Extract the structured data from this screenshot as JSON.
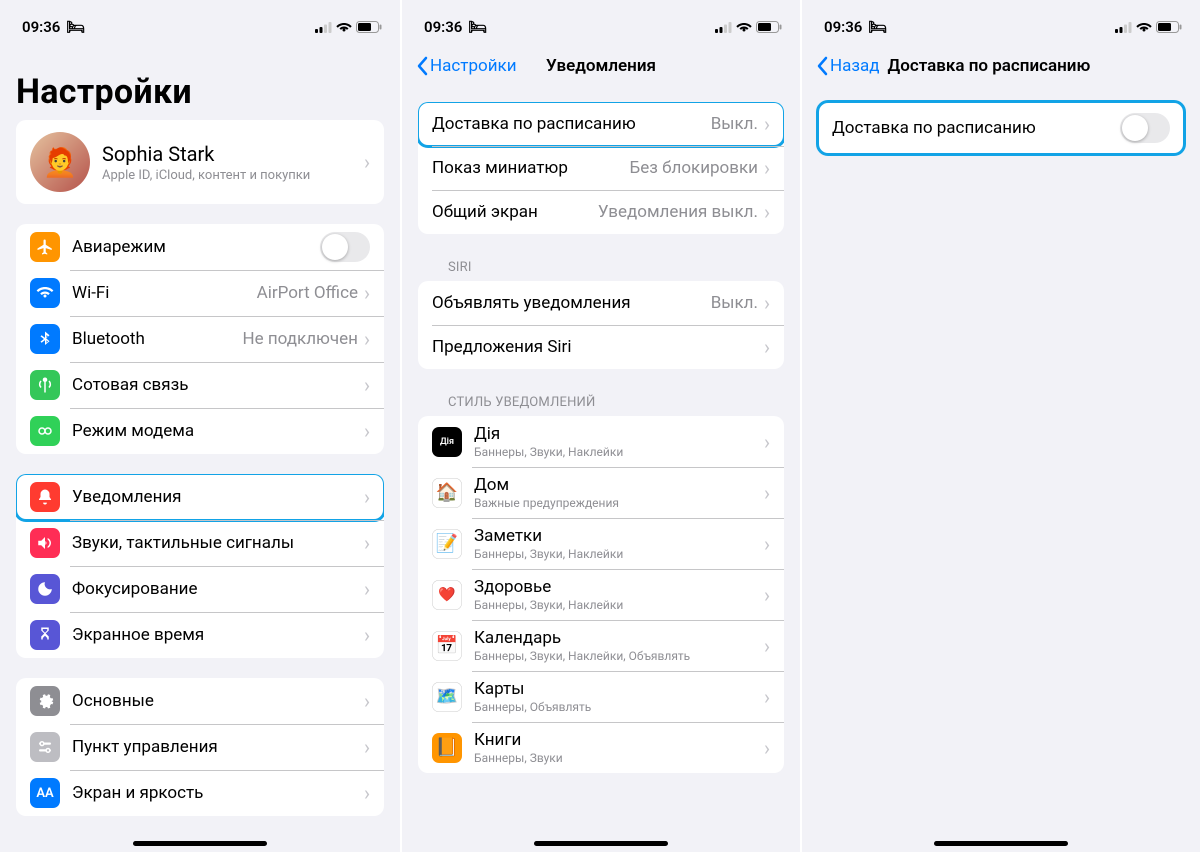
{
  "status": {
    "time": "09:36",
    "bed_icon": "bed-icon"
  },
  "screen1": {
    "title": "Настройки",
    "profile": {
      "name": "Sophia Stark",
      "sub": "Apple ID, iCloud, контент и покупки"
    },
    "group_network": [
      {
        "label": "Авиарежим",
        "type": "switch",
        "icon_bg": "bg-orange"
      },
      {
        "label": "Wi-Fi",
        "value": "AirPort Office",
        "icon_bg": "bg-blue"
      },
      {
        "label": "Bluetooth",
        "value": "Не подключен",
        "icon_bg": "bg-blue"
      },
      {
        "label": "Сотовая связь",
        "icon_bg": "bg-green"
      },
      {
        "label": "Режим модема",
        "icon_bg": "bg-greenalt"
      }
    ],
    "group_notif": [
      {
        "label": "Уведомления",
        "icon_bg": "bg-red",
        "highlight": true
      },
      {
        "label": "Звуки, тактильные сигналы",
        "icon_bg": "bg-pink"
      },
      {
        "label": "Фокусирование",
        "icon_bg": "bg-indigo"
      },
      {
        "label": "Экранное время",
        "icon_bg": "bg-indigo"
      }
    ],
    "group_general": [
      {
        "label": "Основные",
        "icon_bg": "bg-gray"
      },
      {
        "label": "Пункт управления",
        "icon_bg": "bg-graylight"
      },
      {
        "label": "Экран и яркость",
        "icon_bg": "bg-blue"
      }
    ]
  },
  "screen2": {
    "back": "Настройки",
    "title": "Уведомления",
    "group_top": [
      {
        "label": "Доставка по расписанию",
        "value": "Выкл.",
        "highlight": true
      },
      {
        "label": "Показ миниатюр",
        "value": "Без блокировки"
      },
      {
        "label": "Общий экран",
        "value": "Уведомления выкл."
      }
    ],
    "header_siri": "SIRI",
    "group_siri": [
      {
        "label": "Объявлять уведомления",
        "value": "Выкл."
      },
      {
        "label": "Предложения Siri"
      }
    ],
    "header_style": "СТИЛЬ УВЕДОМЛЕНИЙ",
    "apps": [
      {
        "label": "Дія",
        "sub": "Баннеры, Звуки, Наклейки",
        "bg": "bg-black",
        "glyph": "Дія"
      },
      {
        "label": "Дом",
        "sub": "Важные предупреждения",
        "bg": "bg-white",
        "emoji": "🏠"
      },
      {
        "label": "Заметки",
        "sub": "Баннеры, Звуки, Наклейки",
        "bg": "bg-white",
        "emoji": "📝"
      },
      {
        "label": "Здоровье",
        "sub": "Баннеры, Звуки, Наклейки",
        "bg": "bg-white",
        "emoji": "❤️"
      },
      {
        "label": "Календарь",
        "sub": "Баннеры, Звуки, Наклейки, Объявлять",
        "bg": "bg-white",
        "emoji": "📅"
      },
      {
        "label": "Карты",
        "sub": "Баннеры, Объявлять",
        "bg": "bg-white",
        "emoji": "🗺️"
      },
      {
        "label": "Книги",
        "sub": "Баннеры, Звуки",
        "bg": "bg-orange",
        "emoji": "📙"
      }
    ]
  },
  "screen3": {
    "back": "Назад",
    "title": "Доставка по расписанию",
    "toggle_label": "Доставка по расписанию"
  }
}
